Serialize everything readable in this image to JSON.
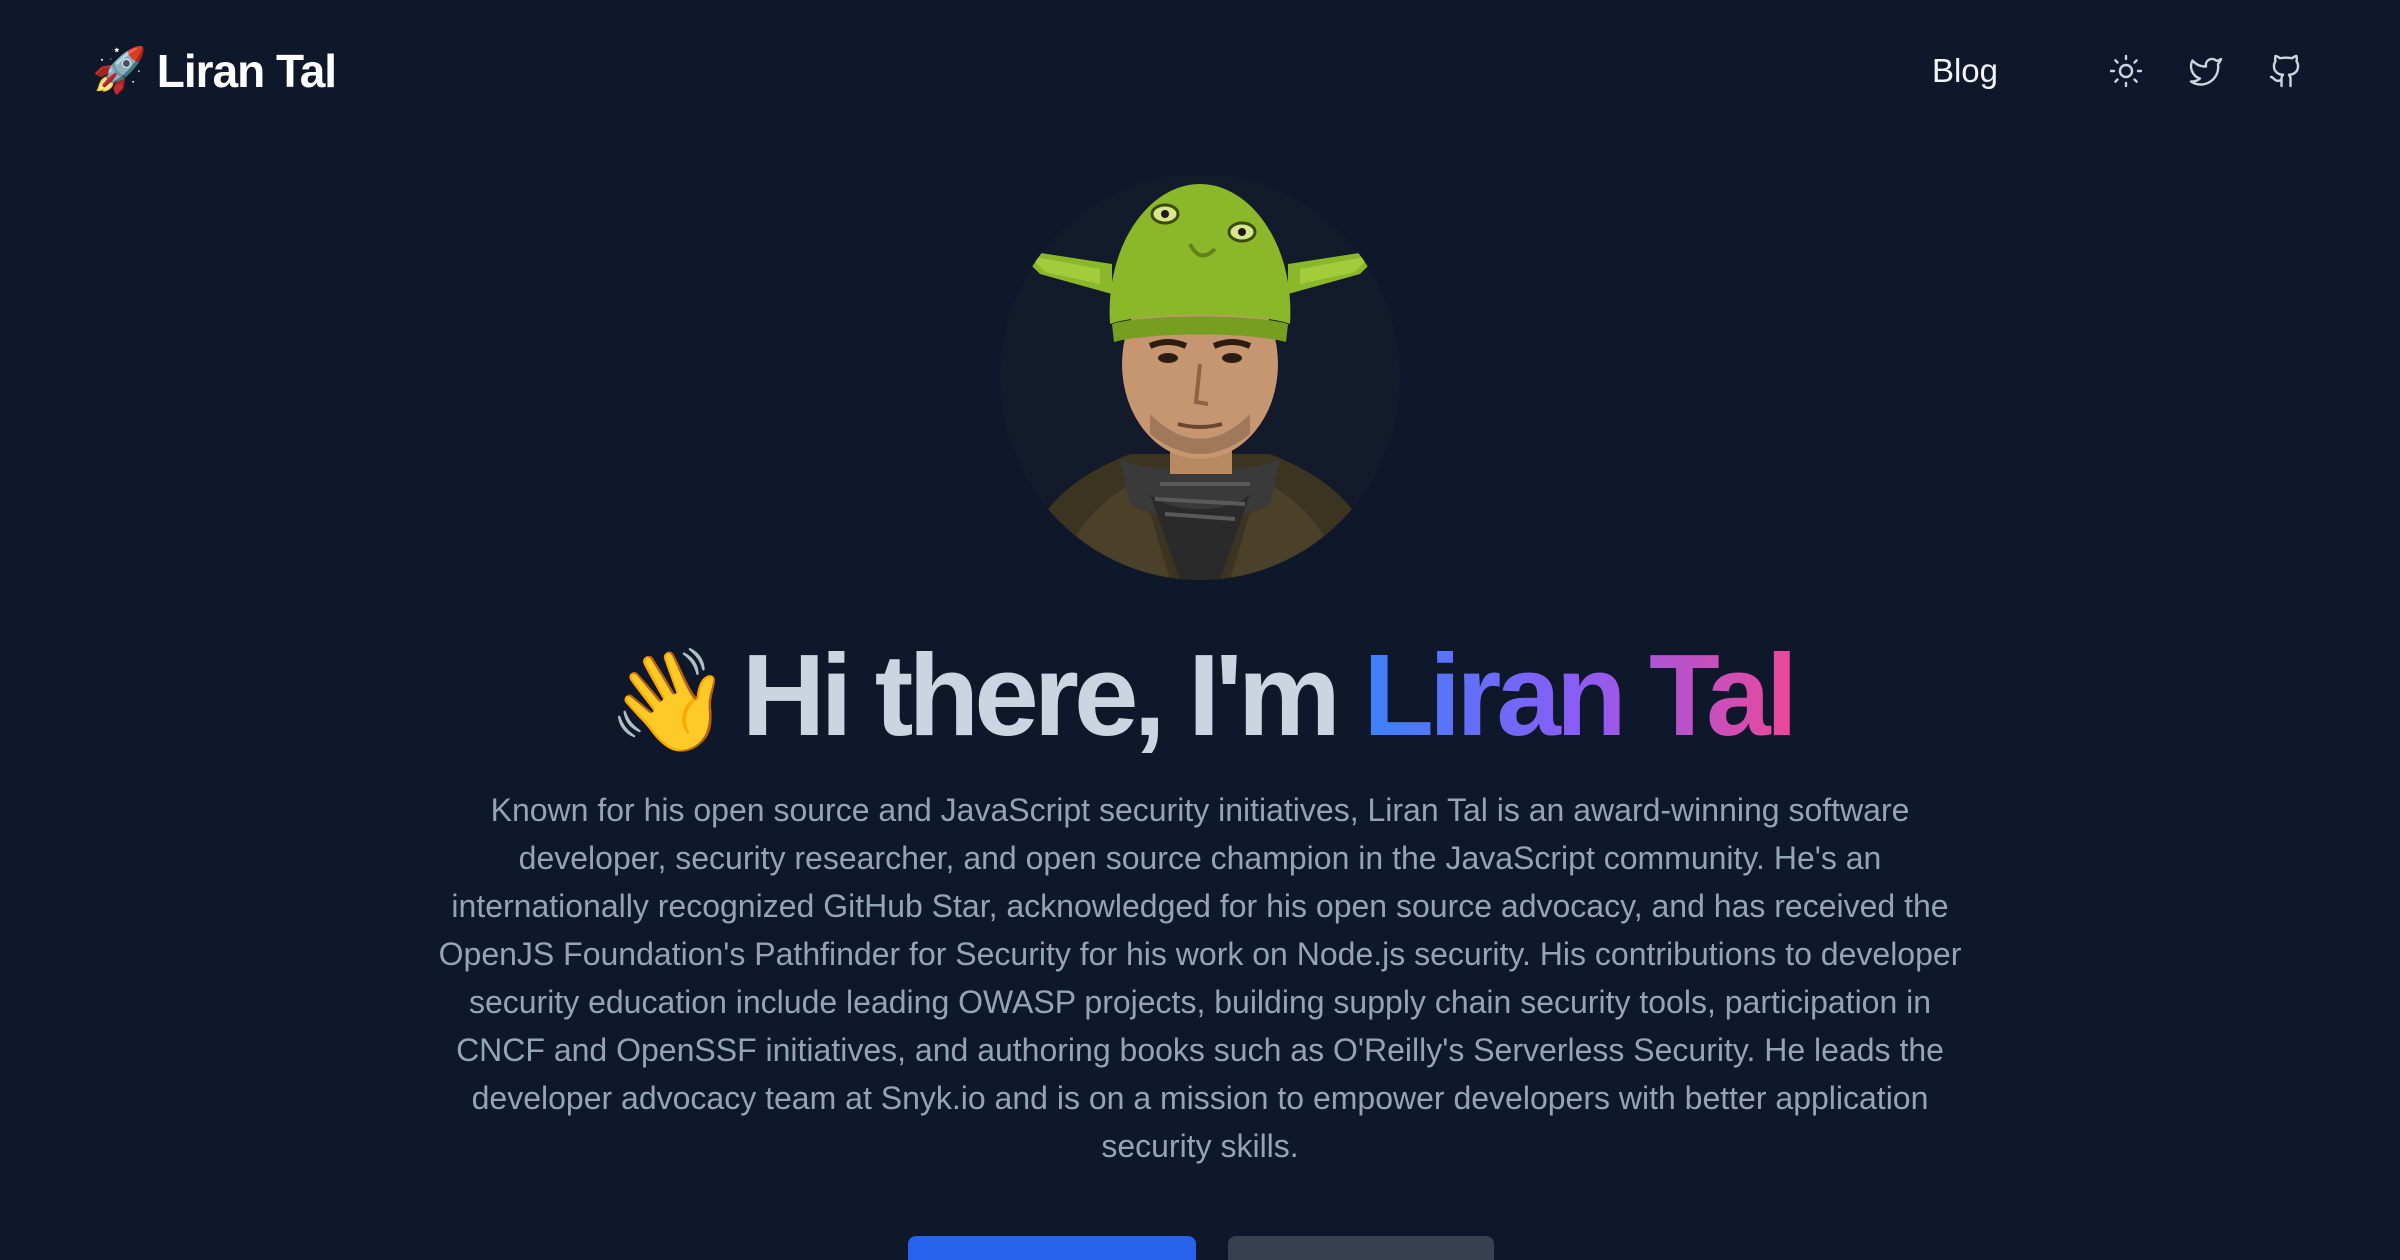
{
  "header": {
    "brand_icon": "🚀",
    "brand_name": "Liran Tal",
    "nav": {
      "blog_label": "Blog"
    },
    "icons": [
      "sun-icon",
      "twitter-icon",
      "github-icon"
    ]
  },
  "hero": {
    "avatar_alt": "Liran Tal avatar",
    "headline": {
      "wave": "👋",
      "greeting": "Hi there, I'm",
      "name": "Liran Tal"
    },
    "bio": "Known for his open source and JavaScript security initiatives, Liran Tal is an award-winning software developer, security researcher, and open source champion in the JavaScript community. He's an internationally recognized GitHub Star, acknowledged for his open source advocacy, and has received the OpenJS Foundation's Pathfinder for Security for his work on Node.js security. His contributions to developer security education include leading OWASP projects, building supply chain security tools, participation in CNCF and OpenSSF initiatives, and authoring books such as O'Reilly's Serverless Security. He leads the developer advocacy team at Snyk.io and is on a mission to empower developers with better application security skills.",
    "buttons": {
      "primary_label": "",
      "secondary_label": ""
    }
  },
  "colors": {
    "background": "#0f172a",
    "gradient_start": "#3b82f6",
    "gradient_mid": "#8b5cf6",
    "gradient_end": "#ec4899",
    "primary_button": "#2563eb",
    "secondary_button": "#374151"
  }
}
